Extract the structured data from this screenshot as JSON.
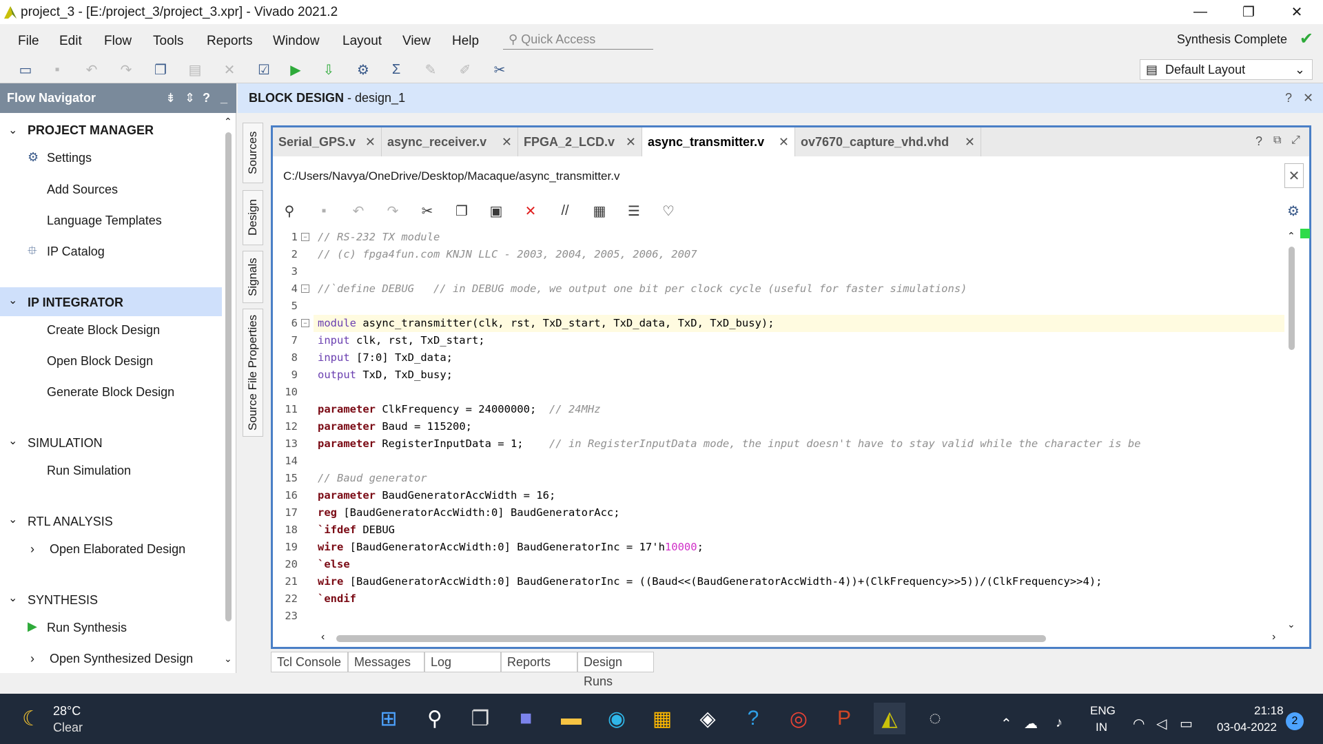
{
  "window": {
    "title": "project_3 - [E:/project_3/project_3.xpr] - Vivado 2021.2",
    "min": "—",
    "max": "❐",
    "close": "✕"
  },
  "menu": [
    "File",
    "Edit",
    "Flow",
    "Tools",
    "Reports",
    "Window",
    "Layout",
    "View",
    "Help"
  ],
  "quick_access": {
    "placeholder": "Quick Access"
  },
  "status": "Synthesis Complete",
  "layout_select": "Default Layout",
  "flow_nav": {
    "title": "Flow Navigator",
    "sections": [
      {
        "label": "PROJECT MANAGER",
        "items": [
          "Settings",
          "Add Sources",
          "Language Templates",
          "IP Catalog"
        ]
      },
      {
        "label": "IP INTEGRATOR",
        "items": [
          "Create Block Design",
          "Open Block Design",
          "Generate Block Design"
        ]
      },
      {
        "label": "SIMULATION",
        "items": [
          "Run Simulation"
        ]
      },
      {
        "label": "RTL ANALYSIS",
        "items": [
          "Open Elaborated Design"
        ]
      },
      {
        "label": "SYNTHESIS",
        "items": [
          "Run Synthesis",
          "Open Synthesized Design"
        ]
      }
    ]
  },
  "block_design": {
    "title": "BLOCK DESIGN",
    "name": " - design_1"
  },
  "side_tabs": [
    "Sources",
    "Design",
    "Signals",
    "Source File Properties"
  ],
  "file_tabs": [
    "Serial_GPS.v",
    "async_receiver.v",
    "FPGA_2_LCD.v",
    "async_transmitter.v",
    "ov7670_capture_vhd.vhd"
  ],
  "file_path": "C:/Users/Navya/OneDrive/Desktop/Macaque/async_transmitter.v",
  "code_lines": [
    "1",
    "2",
    "3",
    "4",
    "5",
    "6",
    "7",
    "8",
    "9",
    "10",
    "11",
    "12",
    "13",
    "14",
    "15",
    "16",
    "17",
    "18",
    "19",
    "20",
    "21",
    "22",
    "23"
  ],
  "code": {
    "l1": "// RS-232 TX module",
    "l2": "// (c) fpga4fun.com KNJN LLC - 2003, 2004, 2005, 2006, 2007",
    "l4": "//`define DEBUG   // in DEBUG mode, we output one bit per clock cycle (useful for faster simulations)",
    "l6a": "module",
    "l6b": " async_transmitter(clk, rst, TxD_start, TxD_data, TxD, TxD_busy);",
    "l7a": "input",
    "l7b": " clk, rst, TxD_start;",
    "l8a": "input",
    "l8b": " [7:0] TxD_data;",
    "l9a": "output",
    "l9b": " TxD, TxD_busy;",
    "l11a": "parameter",
    "l11b": " ClkFrequency = 24000000;  ",
    "l11c": "// 24MHz",
    "l12a": "parameter",
    "l12b": " Baud = 115200;",
    "l13a": "parameter",
    "l13b": " RegisterInputData = 1;    ",
    "l13c": "// in RegisterInputData mode, the input doesn't have to stay valid while the character is be",
    "l15": "// Baud generator",
    "l16a": "parameter",
    "l16b": " BaudGeneratorAccWidth = 16;",
    "l17a": "reg",
    "l17b": " [BaudGeneratorAccWidth:0] BaudGeneratorAcc;",
    "l18a": "`ifdef",
    "l18b": " DEBUG",
    "l19a": "wire",
    "l19b": " [BaudGeneratorAccWidth:0] BaudGeneratorInc = 17'h",
    "l19c": "10000",
    "l19d": ";",
    "l20a": "`else",
    "l21a": "wire",
    "l21b": " [BaudGeneratorAccWidth:0] BaudGeneratorInc = ((Baud<<(BaudGeneratorAccWidth-4))+(ClkFrequency>>5))/(ClkFrequency>>4);",
    "l22a": "`endif"
  },
  "bottom_tabs": [
    "Tcl Console",
    "Messages",
    "Log",
    "Reports",
    "Design Runs"
  ],
  "taskbar": {
    "weather_temp": "28°C",
    "weather_text": "Clear",
    "lang1": "ENG",
    "lang2": "IN",
    "time": "21:18",
    "date": "03-04-2022",
    "notif": "2"
  }
}
